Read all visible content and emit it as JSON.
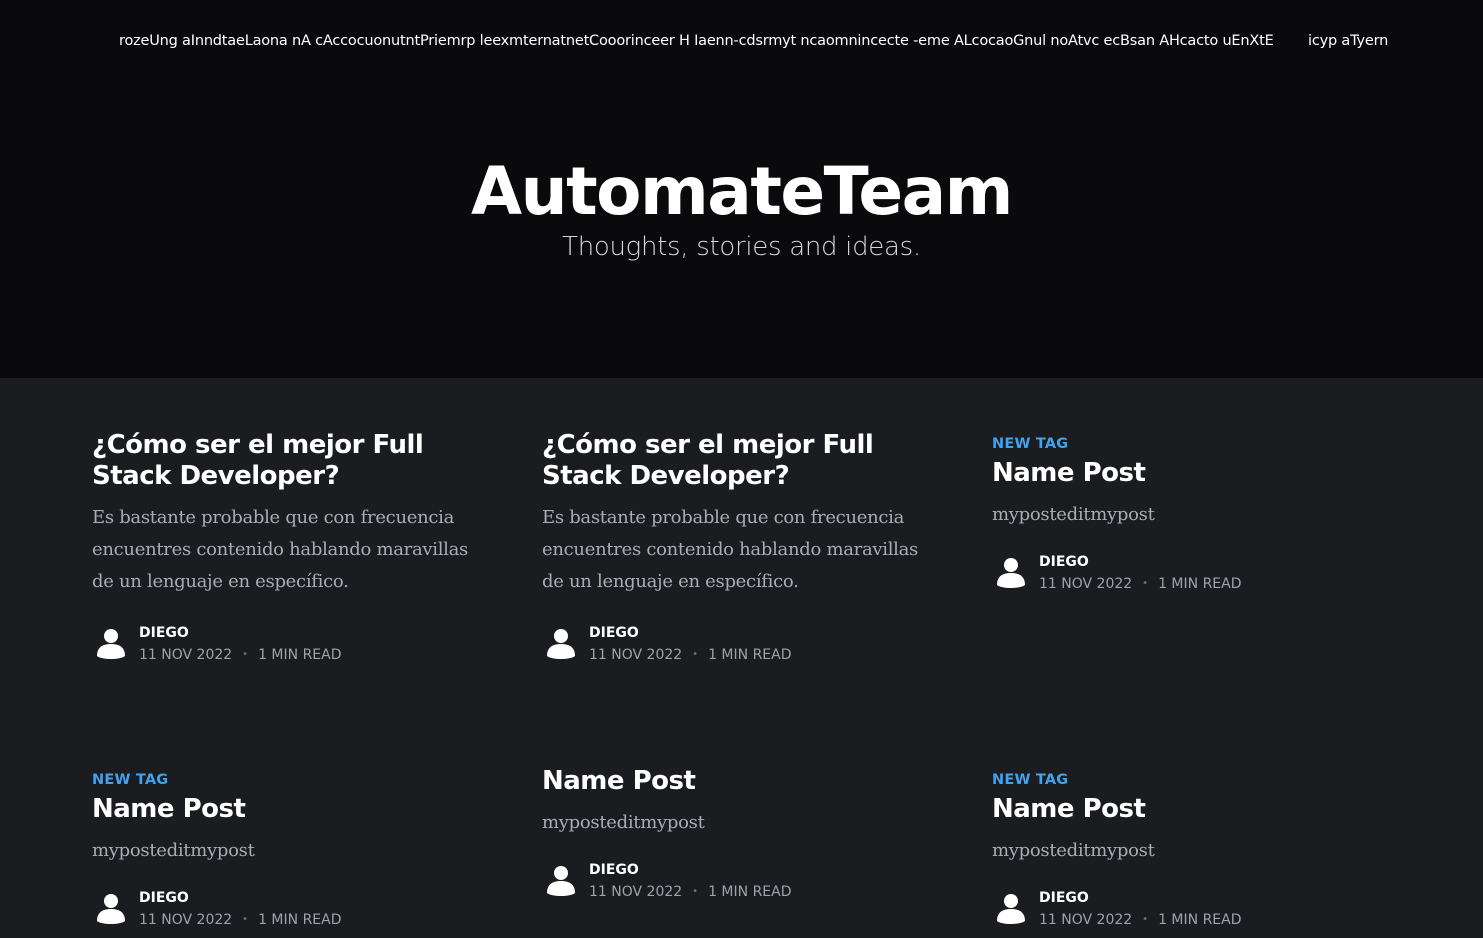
{
  "nav": {
    "links_text": "rozeUng aInndtaeLaona nA cAccocuonutntPriemrp leexmternatnetCooorinceer H Iaenn-cdsrmyt ncaomnincecte -eme ALcocaoGnul noAtvc ecBsan AHcacto uEnXtE",
    "extra_text": "icyp aTyern"
  },
  "site": {
    "title": "AutomateTeam",
    "description": "Thoughts, stories and ideas."
  },
  "posts": [
    {
      "tag": "",
      "title": "¿Cómo ser el mejor Full Stack Developer?",
      "excerpt": "Es bastante probable que con frecuencia encuentres contenido hablando maravillas de un lenguaje en específico.",
      "author": "DIEGO",
      "date": "11 NOV 2022",
      "separator": "•",
      "reading_time": "1 MIN READ",
      "avatar_icon": "user-icon"
    },
    {
      "tag": "",
      "title": "¿Cómo ser el mejor Full Stack Developer?",
      "excerpt": "Es bastante probable que con frecuencia encuentres contenido hablando maravillas de un lenguaje en específico.",
      "author": "DIEGO",
      "date": "11 NOV 2022",
      "separator": "•",
      "reading_time": "1 MIN READ",
      "avatar_icon": "user-icon"
    },
    {
      "tag": "NEW TAG",
      "title": "Name Post",
      "excerpt": "myposteditmypost",
      "author": "DIEGO",
      "date": "11 NOV 2022",
      "separator": "•",
      "reading_time": "1 MIN READ",
      "avatar_icon": "user-icon"
    },
    {
      "tag": "NEW TAG",
      "title": "Name Post",
      "excerpt": "myposteditmypost",
      "author": "DIEGO",
      "date": "11 NOV 2022",
      "separator": "•",
      "reading_time": "1 MIN READ",
      "avatar_icon": "user-icon"
    },
    {
      "tag": "",
      "title": "Name Post",
      "excerpt": "myposteditmypost",
      "author": "DIEGO",
      "date": "11 NOV 2022",
      "separator": "•",
      "reading_time": "1 MIN READ",
      "avatar_icon": "user-icon"
    },
    {
      "tag": "NEW TAG",
      "title": "Name Post",
      "excerpt": "myposteditmypost",
      "author": "DIEGO",
      "date": "11 NOV 2022",
      "separator": "•",
      "reading_time": "1 MIN READ",
      "avatar_icon": "user-icon"
    }
  ],
  "colors": {
    "header_bg": "#0a0a0c",
    "body_bg": "#1b1c20",
    "tag_accent": "#3fa3f0"
  }
}
